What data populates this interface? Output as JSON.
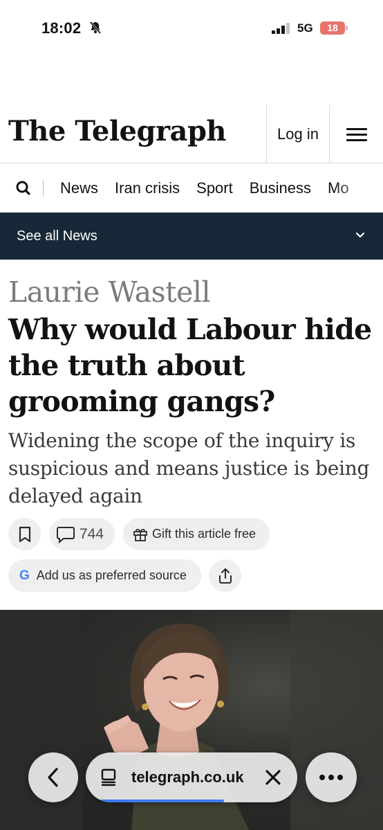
{
  "status_bar": {
    "time": "18:02",
    "network": "5G",
    "battery": "18",
    "battery_color": "#e8736b"
  },
  "masthead": {
    "logo": "The Telegraph",
    "login_label": "Log in",
    "menu_icon": "hamburger-icon"
  },
  "nav": {
    "search_icon": "search-icon",
    "items": [
      "News",
      "Iran crisis",
      "Sport",
      "Business",
      "Mo"
    ]
  },
  "section_bar": {
    "label": "See all News",
    "background": "#172938"
  },
  "article": {
    "author": "Laurie Wastell",
    "headline": "Why would Labour hide the truth about grooming gangs?",
    "standfirst": "Widening the scope of the inquiry is suspicious and means justice is being delayed again",
    "comment_count": "744",
    "gift_label": "Gift this article free",
    "preferred_source_label": "Add us as preferred source",
    "google_g": "G"
  },
  "browser": {
    "url": "telegraph.co.uk",
    "page_load_progress": 0.6,
    "accent": "#3b7cf6"
  }
}
